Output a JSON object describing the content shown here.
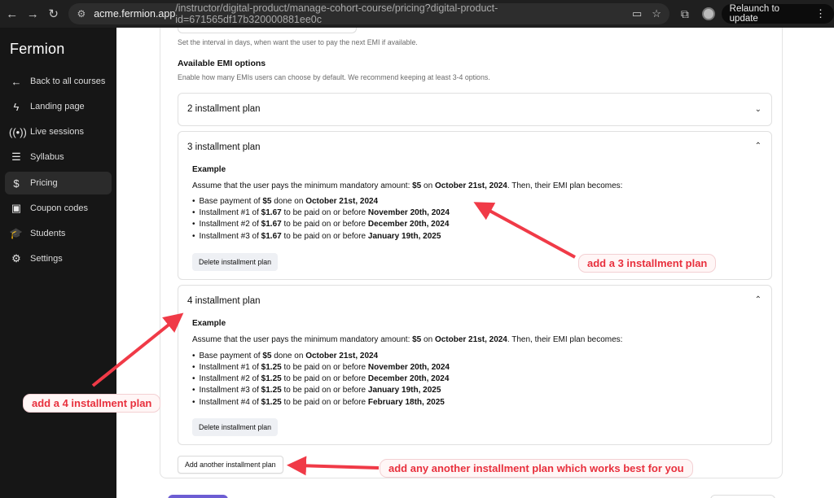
{
  "browser": {
    "url_domain": "acme.fermion.app",
    "url_path": "/instructor/digital-product/manage-cohort-course/pricing?digital-product-id=671565df17b320000881ee0c",
    "relaunch_label": "Relaunch to update"
  },
  "sidebar": {
    "brand": "Fermion",
    "items": [
      {
        "label": "Back to all courses",
        "icon": "arrow-left-icon"
      },
      {
        "label": "Landing page",
        "icon": "lightning-icon"
      },
      {
        "label": "Live sessions",
        "icon": "broadcast-icon"
      },
      {
        "label": "Syllabus",
        "icon": "list-icon"
      },
      {
        "label": "Pricing",
        "icon": "dollar-icon",
        "active": true
      },
      {
        "label": "Coupon codes",
        "icon": "ticket-icon"
      },
      {
        "label": "Students",
        "icon": "graduation-cap-icon"
      },
      {
        "label": "Settings",
        "icon": "gear-icon"
      }
    ]
  },
  "main": {
    "interval_helper": "Set the interval in days, when want the user to pay the next EMI if available.",
    "emi_title": "Available EMI options",
    "emi_subtitle": "Enable how many EMIs users can choose by default. We recommend keeping at least 3-4 options.",
    "plans": [
      {
        "title": "2 installment plan",
        "expanded": false
      },
      {
        "title": "3 installment plan",
        "expanded": true,
        "example_label": "Example",
        "assume_prefix": "Assume that the user pays the minimum mandatory amount: ",
        "assume_amount": "$5",
        "assume_on": " on ",
        "assume_date": "October 21st, 2024",
        "assume_suffix": ". Then, their EMI plan becomes:",
        "items": [
          {
            "a": "Base payment of ",
            "amt": "$5",
            "b": " done on ",
            "date": "October 21st, 2024"
          },
          {
            "a": "Installment #1 of ",
            "amt": "$1.67",
            "b": " to be paid on or before ",
            "date": "November 20th, 2024"
          },
          {
            "a": "Installment #2 of ",
            "amt": "$1.67",
            "b": " to be paid on or before ",
            "date": "December 20th, 2024"
          },
          {
            "a": "Installment #3 of ",
            "amt": "$1.67",
            "b": " to be paid on or before ",
            "date": "January 19th, 2025"
          }
        ],
        "delete_label": "Delete installment plan"
      },
      {
        "title": "4 installment plan",
        "expanded": true,
        "example_label": "Example",
        "assume_prefix": "Assume that the user pays the minimum mandatory amount: ",
        "assume_amount": "$5",
        "assume_on": " on ",
        "assume_date": "October 21st, 2024",
        "assume_suffix": ". Then, their EMI plan becomes:",
        "items": [
          {
            "a": "Base payment of ",
            "amt": "$5",
            "b": " done on ",
            "date": "October 21st, 2024"
          },
          {
            "a": "Installment #1 of ",
            "amt": "$1.25",
            "b": " to be paid on or before ",
            "date": "November 20th, 2024"
          },
          {
            "a": "Installment #2 of ",
            "amt": "$1.25",
            "b": " to be paid on or before ",
            "date": "December 20th, 2024"
          },
          {
            "a": "Installment #3 of ",
            "amt": "$1.25",
            "b": " to be paid on or before ",
            "date": "January 19th, 2025"
          },
          {
            "a": "Installment #4 of ",
            "amt": "$1.25",
            "b": " to be paid on or before ",
            "date": "February 18th, 2025"
          }
        ],
        "delete_label": "Delete installment plan"
      }
    ],
    "add_label": "Add another installment plan"
  },
  "annotations": {
    "callout_3": "add a 3 installment plan",
    "callout_4": "add a 4 installment plan",
    "callout_add": "add any another installment plan which works best for you",
    "color": "#e8303d"
  }
}
